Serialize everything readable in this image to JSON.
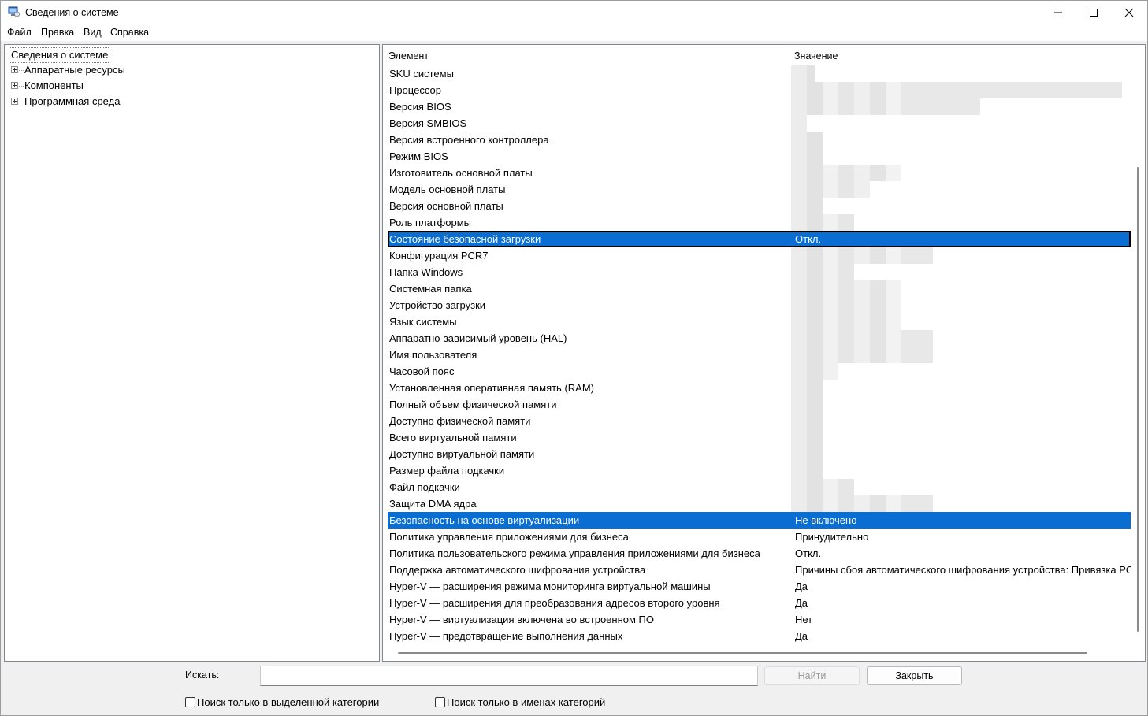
{
  "window": {
    "title": "Сведения о системе",
    "accent": "#0a6dd2"
  },
  "menu": [
    "Файл",
    "Правка",
    "Вид",
    "Справка"
  ],
  "tree": {
    "root": "Сведения о системе",
    "children": [
      "Аппаратные ресурсы",
      "Компоненты",
      "Программная среда"
    ]
  },
  "list": {
    "headers": [
      "Элемент",
      "Значение"
    ],
    "rows": [
      {
        "item": "SKU системы",
        "value": ""
      },
      {
        "item": "Процессор",
        "value": ""
      },
      {
        "item": "Версия BIOS",
        "value": ""
      },
      {
        "item": "Версия SMBIOS",
        "value": ""
      },
      {
        "item": "Версия встроенного контроллера",
        "value": ""
      },
      {
        "item": "Режим BIOS",
        "value": ""
      },
      {
        "item": "Изготовитель основной платы",
        "value": ""
      },
      {
        "item": "Модель основной платы",
        "value": ""
      },
      {
        "item": "Версия основной платы",
        "value": ""
      },
      {
        "item": "Роль платформы",
        "value": ""
      },
      {
        "item": "Состояние безопасной загрузки",
        "value": "Откл."
      },
      {
        "item": "Конфигурация PCR7",
        "value": ""
      },
      {
        "item": "Папка Windows",
        "value": ""
      },
      {
        "item": "Системная папка",
        "value": ""
      },
      {
        "item": "Устройство загрузки",
        "value": ""
      },
      {
        "item": "Язык системы",
        "value": ""
      },
      {
        "item": "Аппаратно-зависимый уровень (HAL)",
        "value": ""
      },
      {
        "item": "Имя пользователя",
        "value": ""
      },
      {
        "item": "Часовой пояс",
        "value": ""
      },
      {
        "item": "Установленная оперативная память (RAM)",
        "value": ""
      },
      {
        "item": "Полный объем физической памяти",
        "value": ""
      },
      {
        "item": "Доступно физической памяти",
        "value": ""
      },
      {
        "item": "Всего виртуальной памяти",
        "value": ""
      },
      {
        "item": "Доступно виртуальной памяти",
        "value": ""
      },
      {
        "item": "Размер файла подкачки",
        "value": ""
      },
      {
        "item": "Файл подкачки",
        "value": ""
      },
      {
        "item": "Защита DMA ядра",
        "value": ""
      },
      {
        "item": "Безопасность на основе виртуализации",
        "value": "Не включено"
      },
      {
        "item": "Политика управления приложениями для бизнеса",
        "value": "Принудительно"
      },
      {
        "item": "Политика пользовательского режима управления приложениями для бизнеса",
        "value": "Откл."
      },
      {
        "item": "Поддержка автоматического шифрования устройства",
        "value": "Причины сбоя автоматического шифрования устройства: Привязка PC"
      },
      {
        "item": "Hyper-V — расширения режима мониторинга виртуальной машины",
        "value": "Да"
      },
      {
        "item": "Hyper-V — расширения для преобразования адресов второго уровня",
        "value": "Да"
      },
      {
        "item": "Hyper-V — виртуализация включена во встроенном ПО",
        "value": "Нет"
      },
      {
        "item": "Hyper-V — предотвращение выполнения данных",
        "value": "Да"
      }
    ]
  },
  "search": {
    "label": "Искать:",
    "value": "",
    "find_button": "Найти",
    "close_button": "Закрыть",
    "cb_selected_category": "Поиск только в выделенной категории",
    "cb_category_names": "Поиск только в именах категорий"
  }
}
